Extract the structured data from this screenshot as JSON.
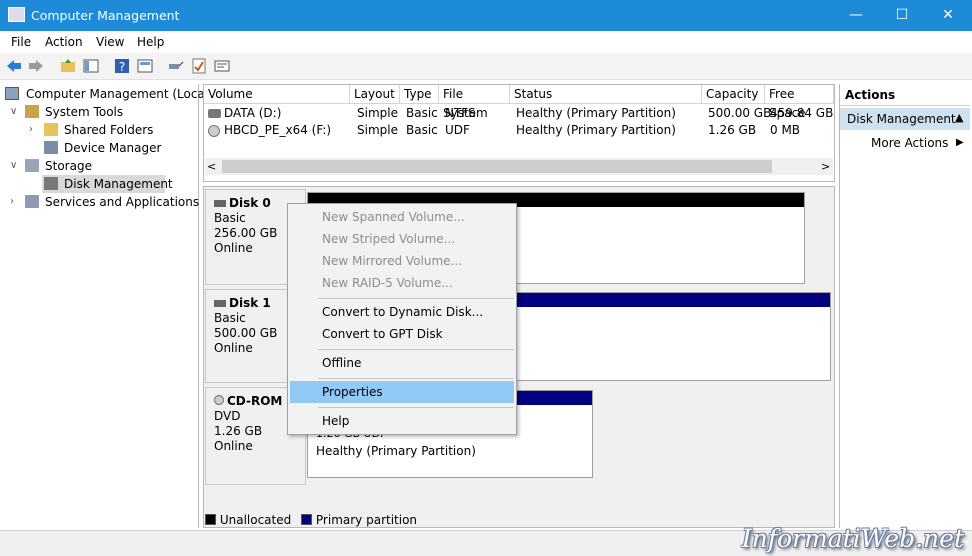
{
  "window": {
    "title": "Computer Management",
    "minimize": "—",
    "maximize": "☐",
    "close": "✕"
  },
  "menu": [
    "File",
    "Action",
    "View",
    "Help"
  ],
  "tree": {
    "root": "Computer Management (Local)",
    "system_tools": "System Tools",
    "shared_folders": "Shared Folders",
    "device_manager": "Device Manager",
    "storage": "Storage",
    "disk_management": "Disk Management",
    "services": "Services and Applications"
  },
  "volume_list": {
    "headers": [
      "Volume",
      "Layout",
      "Type",
      "File System",
      "Status",
      "Capacity",
      "Free Space"
    ],
    "rows": [
      [
        "DATA (D:)",
        "Simple",
        "Basic",
        "NTFS",
        "Healthy (Primary Partition)",
        "500.00 GB",
        "459.84 GB"
      ],
      [
        "HBCD_PE_x64 (F:)",
        "Simple",
        "Basic",
        "UDF",
        "Healthy (Primary Partition)",
        "1.26 GB",
        "0 MB"
      ]
    ],
    "scroll_left": "<",
    "scroll_right": ">"
  },
  "disks": [
    {
      "name": "Disk 0",
      "type": "Basic",
      "size": "256.00 GB",
      "state": "Online"
    },
    {
      "name": "Disk 1",
      "type": "Basic",
      "size": "500.00 GB",
      "state": "Online"
    },
    {
      "name": "CD-ROM 0",
      "type": "DVD",
      "size": "1.26 GB",
      "state": "Online",
      "volume_size": "1.26 GB UDF",
      "volume_status": "Healthy (Primary Partition)"
    }
  ],
  "legend": {
    "unallocated": "Unallocated",
    "primary": "Primary partition",
    "unallocated_color": "#000000",
    "primary_color": "#000080"
  },
  "actions": {
    "title": "Actions",
    "section": "Disk Management",
    "more": "More Actions",
    "collapse_arrow": "▲",
    "more_arrow": "▶"
  },
  "context_menu": {
    "items": [
      "New Spanned Volume...",
      "New Striped Volume...",
      "New Mirrored Volume...",
      "New RAID-5 Volume...",
      "Convert to Dynamic Disk...",
      "Convert to GPT Disk",
      "Offline",
      "Properties",
      "Help"
    ]
  },
  "watermark": "InformatiWeb.net"
}
